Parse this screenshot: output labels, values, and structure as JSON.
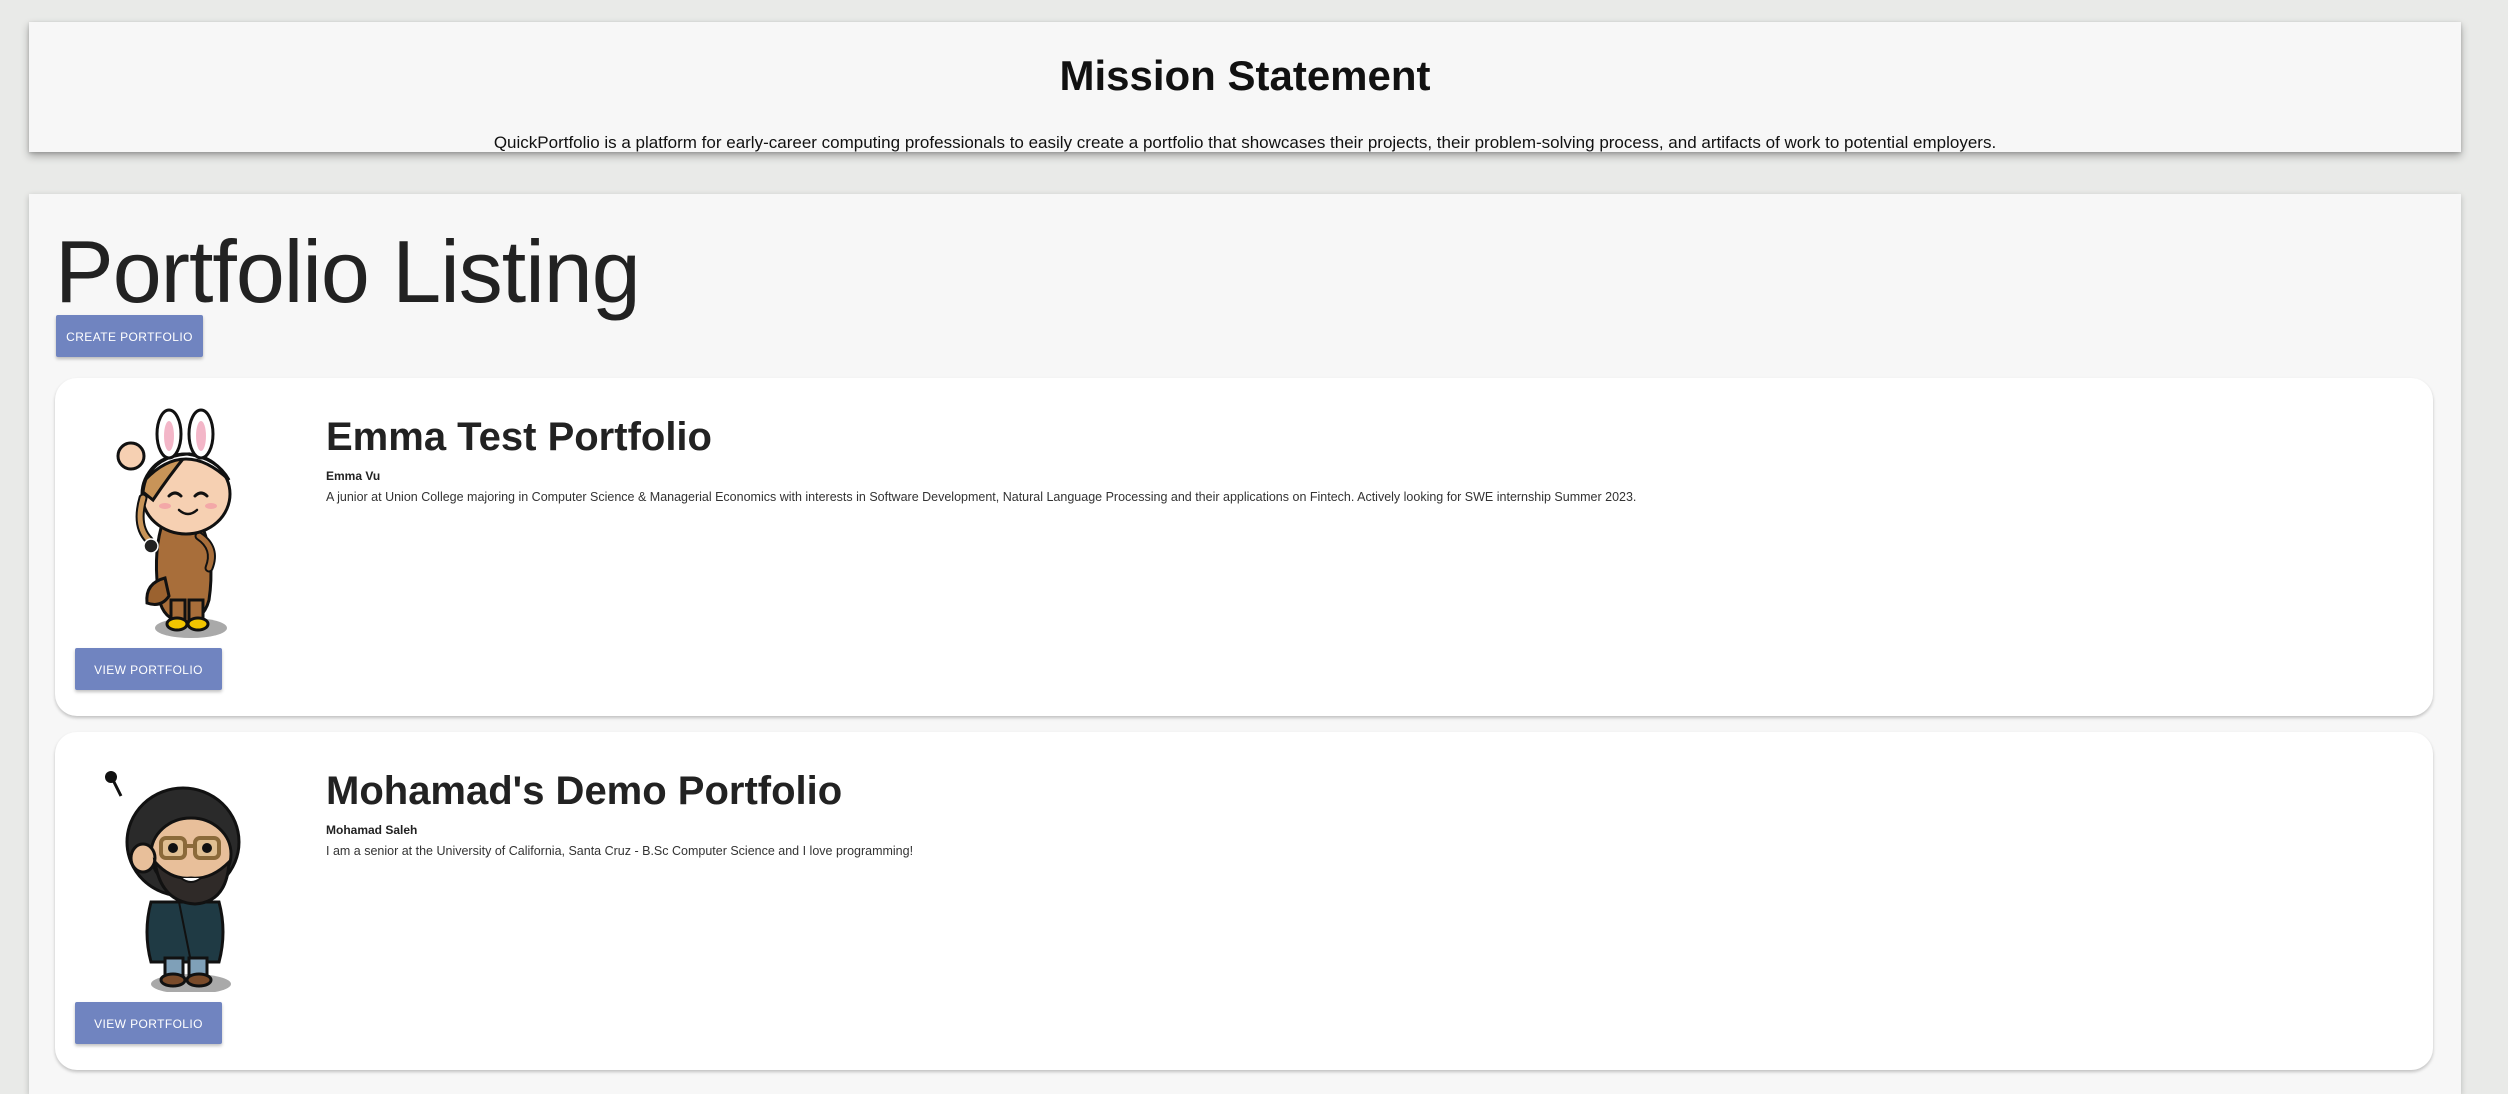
{
  "mission": {
    "title": "Mission Statement",
    "text": "QuickPortfolio is a platform for early-career computing professionals to easily create a portfolio that showcases their projects, their problem-solving process, and artifacts of work to potential employers."
  },
  "listing": {
    "title": "Portfolio Listing",
    "create_label": "CREATE PORTFOLIO",
    "portfolios": [
      {
        "title": "Emma Test Portfolio",
        "owner": "Emma Vu",
        "description": "A junior at Union College majoring in Computer Science & Managerial Economics with interests in Software Development, Natural Language Processing and their applications on Fintech. Actively looking for SWE internship Summer 2023.",
        "view_label": "VIEW PORTFOLIO",
        "avatar": "bunny-hat-avatar"
      },
      {
        "title": "Mohamad's Demo Portfolio",
        "owner": "Mohamad Saleh",
        "description": "I am a senior at the University of California, Santa Cruz - B.Sc Computer Science and I love programming!",
        "view_label": "VIEW PORTFOLIO",
        "avatar": "bearded-glasses-avatar"
      }
    ]
  },
  "colors": {
    "page_background": "#e9eae8",
    "panel_background": "#f7f7f7",
    "card_background": "#ffffff",
    "button": "#7084c0",
    "button_text": "#ffffff"
  }
}
